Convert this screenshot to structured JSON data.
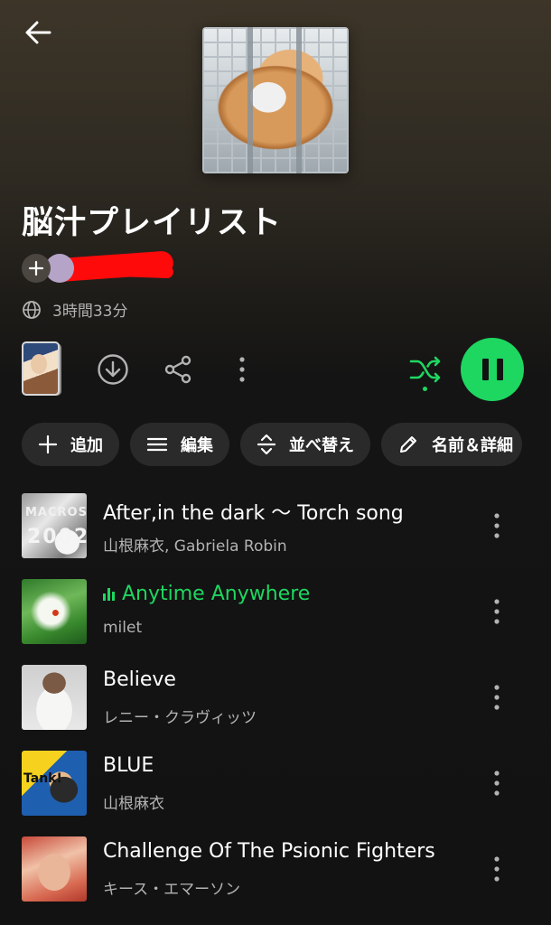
{
  "playlist": {
    "title": "脳汁プレイリスト",
    "owner_name": "",
    "duration": "3時間33分"
  },
  "chips": {
    "add": "追加",
    "edit": "編集",
    "sort": "並べ替え",
    "rename": "名前＆詳細"
  },
  "colors": {
    "accent": "#1ed760",
    "background": "#121212",
    "chip_bg": "#2a2a2a",
    "redaction": "#ff0a0a"
  },
  "tracks": [
    {
      "title": "After,in the dark 〜 Torch song",
      "artist": "山根麻衣, Gabriela Robin",
      "playing": false,
      "art_text_1": "MACROSS",
      "art_text_2": "2002"
    },
    {
      "title": "Anytime Anywhere",
      "artist": "milet",
      "playing": true
    },
    {
      "title": "Believe",
      "artist": "レニー・クラヴィッツ",
      "playing": false
    },
    {
      "title": "BLUE",
      "artist": "山根麻衣",
      "playing": false,
      "art_text_1": "Tank!"
    },
    {
      "title": "Challenge Of The Psionic Fighters",
      "artist": "キース・エマーソン",
      "playing": false
    }
  ],
  "icons": {
    "back": "arrow-left-icon",
    "globe": "globe-icon",
    "download": "download-circle-icon",
    "share": "share-icon",
    "more": "more-vertical-icon",
    "shuffle": "shuffle-icon",
    "pause": "pause-icon",
    "plus": "plus-icon",
    "menu": "menu-icon",
    "sort": "sort-icon",
    "pencil": "pencil-icon",
    "equalizer": "equalizer-icon"
  }
}
